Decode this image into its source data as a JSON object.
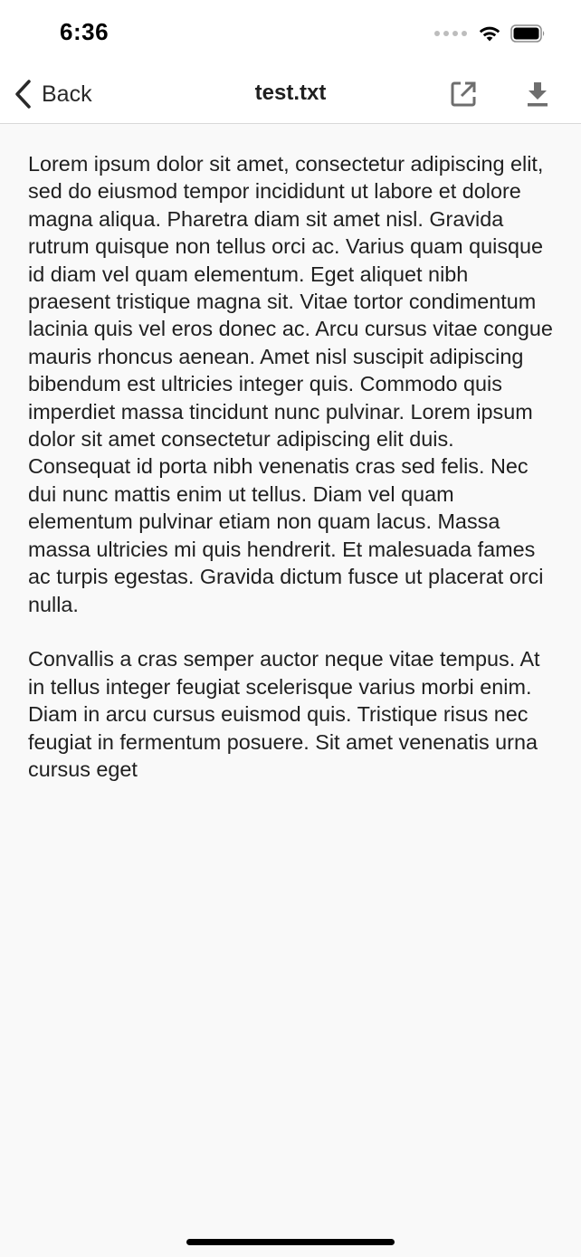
{
  "status_bar": {
    "time": "6:36"
  },
  "nav": {
    "back_label": "Back",
    "title": "test.txt",
    "actions": [
      "open-external-icon",
      "download-icon"
    ]
  },
  "document": {
    "paragraphs": [
      "Lorem ipsum dolor sit amet, consectetur adipiscing elit, sed do eiusmod tempor incididunt ut labore et dolore magna aliqua. Pharetra diam sit amet nisl. Gravida rutrum quisque non tellus orci ac. Varius quam quisque id diam vel quam elementum. Eget aliquet nibh praesent tristique magna sit. Vitae tortor condimentum lacinia quis vel eros donec ac. Arcu cursus vitae congue mauris rhoncus aenean. Amet nisl suscipit adipiscing bibendum est ultricies integer quis. Commodo quis imperdiet massa tincidunt nunc pulvinar. Lorem ipsum dolor sit amet consectetur adipiscing elit duis. Consequat id porta nibh venenatis cras sed felis. Nec dui nunc mattis enim ut tellus. Diam vel quam elementum pulvinar etiam non quam lacus. Massa massa ultricies mi quis hendrerit. Et malesuada fames ac turpis egestas. Gravida dictum fusce ut placerat orci nulla.",
      "Convallis a cras semper auctor neque vitae tempus. At in tellus integer feugiat scelerisque varius morbi enim. Diam in arcu cursus euismod quis. Tristique risus nec feugiat in fermentum posuere. Sit amet venenatis urna cursus eget"
    ]
  }
}
